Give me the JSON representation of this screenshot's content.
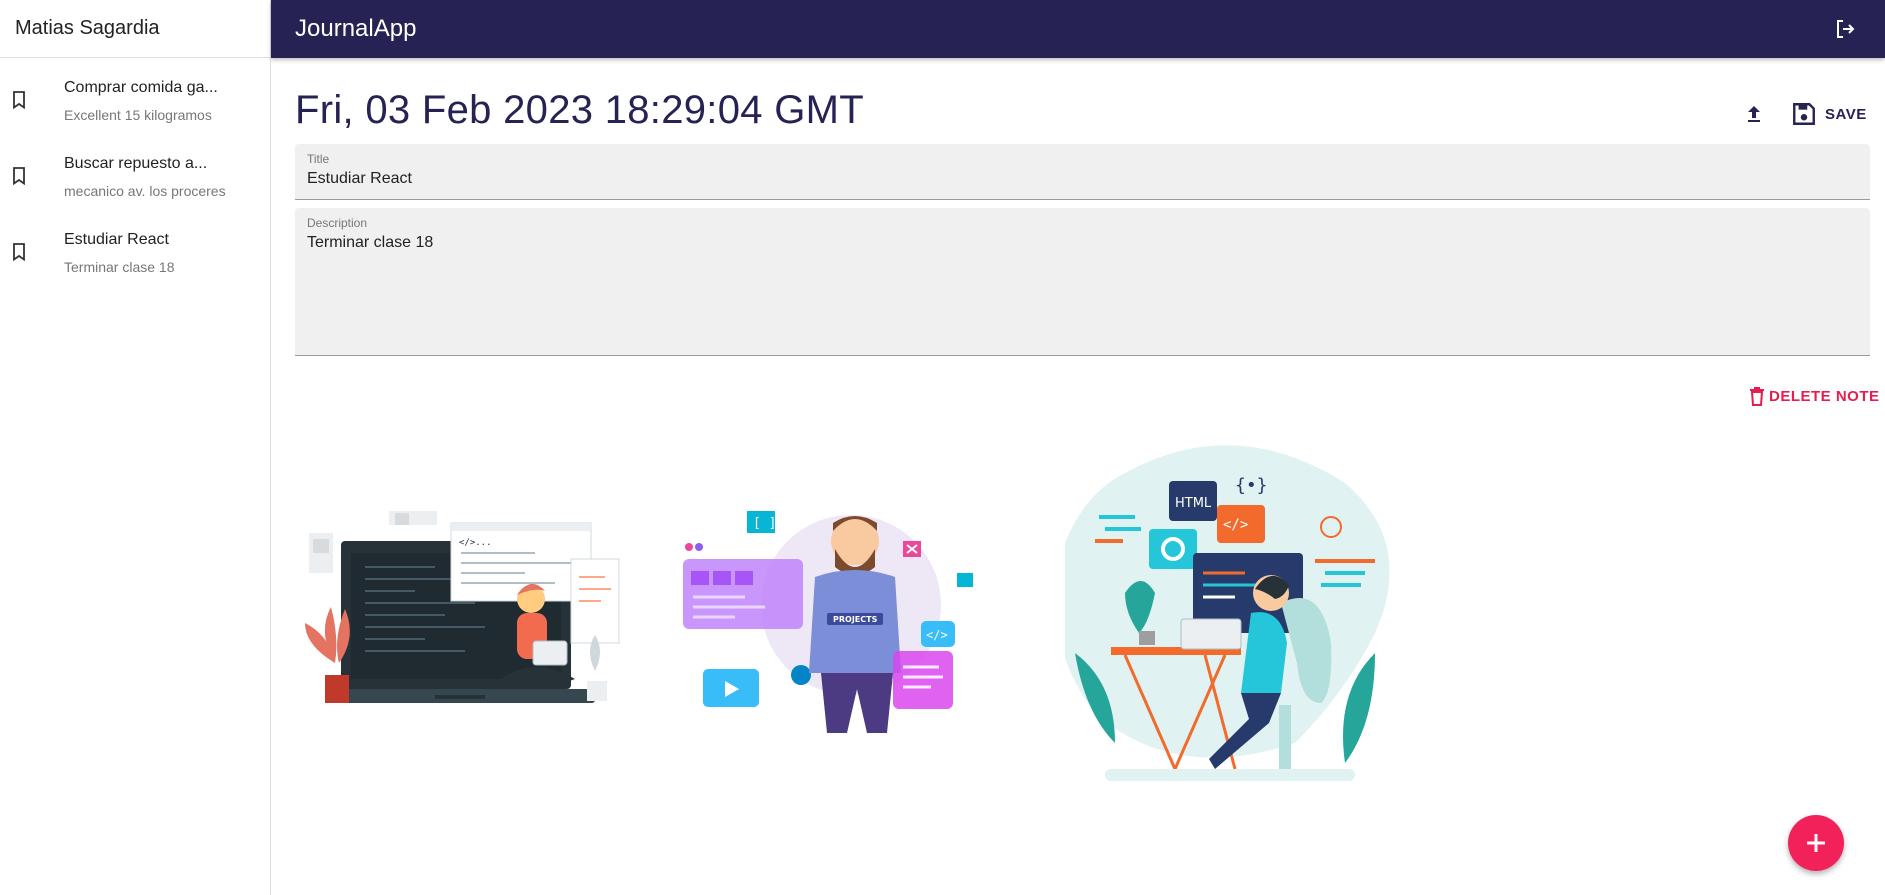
{
  "sidebar": {
    "user_name": "Matias Sagardia",
    "notes": [
      {
        "title": "Comprar comida ga...",
        "body": "Excellent 15 kilogramos",
        "icon": "bookmark-icon"
      },
      {
        "title": "Buscar repuesto a...",
        "body": "mecanico av. los proceres",
        "icon": "bookmark-icon"
      },
      {
        "title": "Estudiar React",
        "body": "Terminar clase 18",
        "icon": "bookmark-icon"
      }
    ]
  },
  "appbar": {
    "title": "JournalApp",
    "logout_icon": "logout-icon"
  },
  "note": {
    "date": "Fri, 03 Feb 2023 18:29:04 GMT",
    "save_label": "SAVE",
    "title_label": "Title",
    "title_value": "Estudiar React",
    "description_label": "Description",
    "description_value": "Terminar clase 18",
    "delete_label": "DELETE NOTE",
    "images": [
      "developer-with-laptop-illustration",
      "developer-projects-illustration",
      "developer-at-desk-html-illustration"
    ]
  },
  "colors": {
    "primary": "#262254",
    "secondary": "#f2215a",
    "error": "#e51e4f",
    "field_bg": "#f0f0f0"
  },
  "fab": {
    "icon": "plus-icon"
  }
}
